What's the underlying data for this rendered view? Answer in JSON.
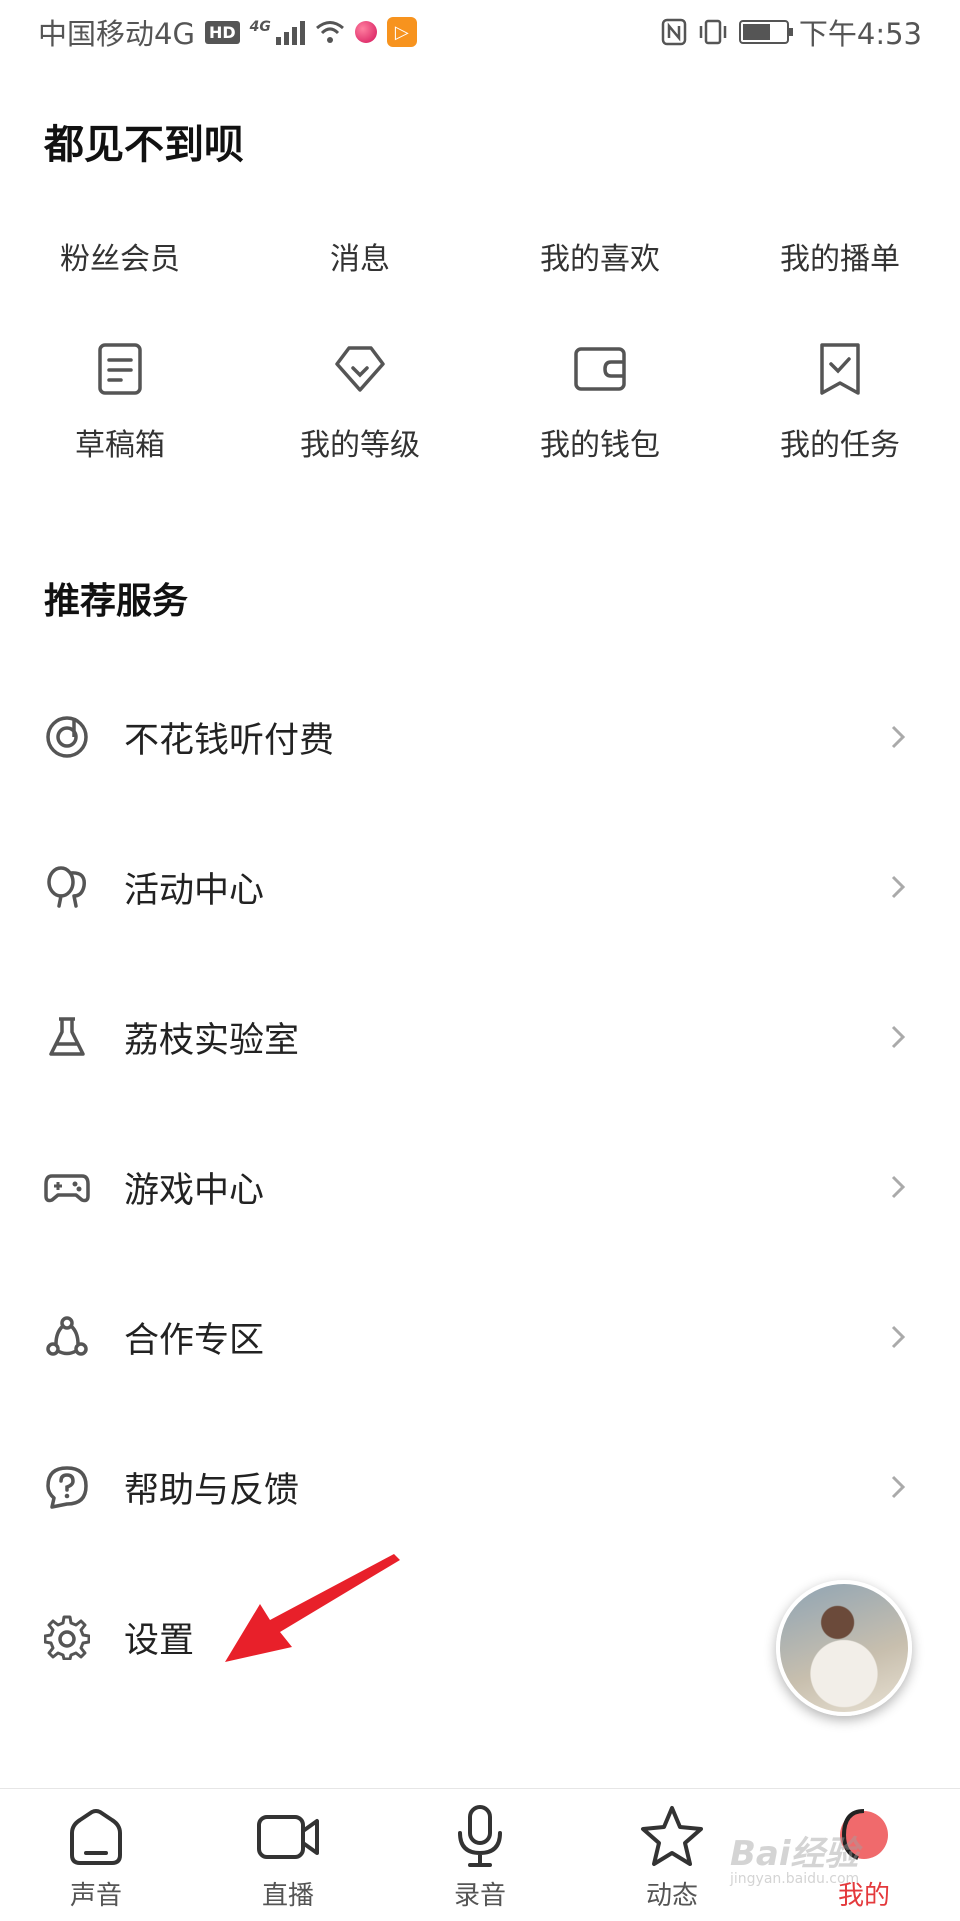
{
  "status_bar": {
    "carrier": "中国移动4G",
    "hd": "HD",
    "network": "4G",
    "time": "下午4:53"
  },
  "profile": {
    "name": "都见不到呗"
  },
  "quick_links": [
    "粉丝会员",
    "消息",
    "我的喜欢",
    "我的播单"
  ],
  "icon_links": [
    {
      "label": "草稿箱",
      "icon": "draft-box-icon"
    },
    {
      "label": "我的等级",
      "icon": "level-icon"
    },
    {
      "label": "我的钱包",
      "icon": "wallet-icon"
    },
    {
      "label": "我的任务",
      "icon": "task-icon"
    }
  ],
  "section": {
    "title": "推荐服务"
  },
  "menu": [
    {
      "label": "不花钱听付费",
      "icon": "free-listen-icon",
      "chevron": true
    },
    {
      "label": "活动中心",
      "icon": "balloon-icon",
      "chevron": true
    },
    {
      "label": "荔枝实验室",
      "icon": "flask-icon",
      "chevron": true
    },
    {
      "label": "游戏中心",
      "icon": "gamepad-icon",
      "chevron": true
    },
    {
      "label": "合作专区",
      "icon": "cooperation-icon",
      "chevron": true
    },
    {
      "label": "帮助与反馈",
      "icon": "help-icon",
      "chevron": true
    },
    {
      "label": "设置",
      "icon": "gear-icon",
      "chevron": false
    }
  ],
  "tab_bar": {
    "tabs": [
      {
        "label": "声音",
        "icon": "home-icon",
        "active": false
      },
      {
        "label": "直播",
        "icon": "video-camera-icon",
        "active": false
      },
      {
        "label": "录音",
        "icon": "microphone-icon",
        "active": false
      },
      {
        "label": "动态",
        "icon": "star-icon",
        "active": false
      },
      {
        "label": "我的",
        "icon": "profile-icon",
        "active": true
      }
    ]
  },
  "colors": {
    "accent": "#e4393c",
    "annotation_arrow": "#e8202a",
    "icon": "#555555"
  },
  "watermark": {
    "text": "Bai经验",
    "sub": "jingyan.baidu.com"
  }
}
